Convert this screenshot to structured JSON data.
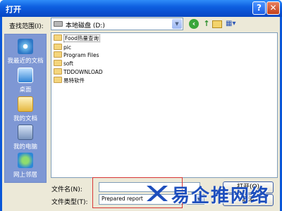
{
  "window": {
    "title": "打开",
    "help_label": "?",
    "close_label": "✕"
  },
  "toolbar": {
    "lookin_label": "查找范围(I):",
    "lookin_value": "本地磁盘 (D:)",
    "back_icon": "back-arrow-icon",
    "up_icon": "up-folder-icon",
    "newfolder_icon": "new-folder-icon",
    "views_icon": "views-menu-icon"
  },
  "places": [
    {
      "label": "我最近的文档",
      "icon": "recent-documents-icon"
    },
    {
      "label": "桌面",
      "icon": "desktop-icon"
    },
    {
      "label": "我的文档",
      "icon": "my-documents-icon"
    },
    {
      "label": "我的电脑",
      "icon": "my-computer-icon"
    },
    {
      "label": "网上邻居",
      "icon": "network-places-icon"
    }
  ],
  "files": [
    {
      "name": "Food热量查询",
      "type": "folder"
    },
    {
      "name": "pic",
      "type": "folder"
    },
    {
      "name": "Program Files",
      "type": "folder"
    },
    {
      "name": "soft",
      "type": "folder"
    },
    {
      "name": "TDDOWNLOAD",
      "type": "folder"
    },
    {
      "name": "易特软件",
      "type": "folder"
    }
  ],
  "form": {
    "filename_label": "文件名(N):",
    "filename_value": "",
    "filetype_label": "文件类型(T):",
    "filetype_value": "Prepared report"
  },
  "buttons": {
    "open_label": "打开(O)",
    "cancel_label": "取消"
  },
  "watermark": {
    "text": "易企推网络"
  },
  "colors": {
    "titlebar": "#0a56d8",
    "sidebar": "#7e97d4",
    "dialog": "#ece9d8",
    "highlight": "#d83535"
  }
}
